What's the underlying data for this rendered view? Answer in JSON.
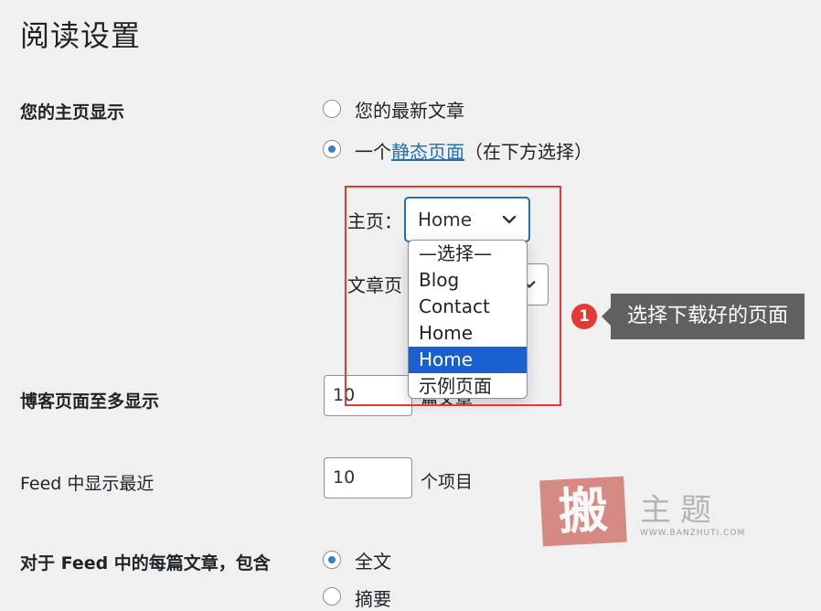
{
  "page_title": "阅读设置",
  "homepage_display": {
    "label": "您的主页显示",
    "option_latest": "您的最新文章",
    "option_static_prefix": "一个",
    "option_static_link": "静态页面",
    "option_static_suffix": "（在下方选择）",
    "selected": "static"
  },
  "front_page": {
    "label": "主页：",
    "value": "Home",
    "dropdown_options": [
      "—选择—",
      "Blog",
      "Contact",
      "Home",
      "Home",
      "示例页面"
    ],
    "highlighted_index": 4
  },
  "posts_page": {
    "label": "文章页"
  },
  "annotation": {
    "number": "1",
    "text": "选择下载好的页面"
  },
  "blog_pages": {
    "label": "博客页面至多显示",
    "value": "10",
    "unit": "篇文章"
  },
  "feed_recent": {
    "label": "Feed 中显示最近",
    "value": "10",
    "unit": "个项目"
  },
  "feed_include": {
    "label": "对于 Feed 中的每篇文章，包含",
    "option_full": "全文",
    "option_summary": "摘要",
    "selected": "full"
  },
  "watermark": {
    "seal": "搬",
    "text": "主题",
    "url": "WWW.BANZHUTI.COM"
  },
  "colors": {
    "accent": "#2271b1",
    "radio_checked": "#3582c4",
    "highlight_box": "#e53935",
    "selected_option": "#1a5fd0",
    "tooltip_bg": "#606060"
  }
}
